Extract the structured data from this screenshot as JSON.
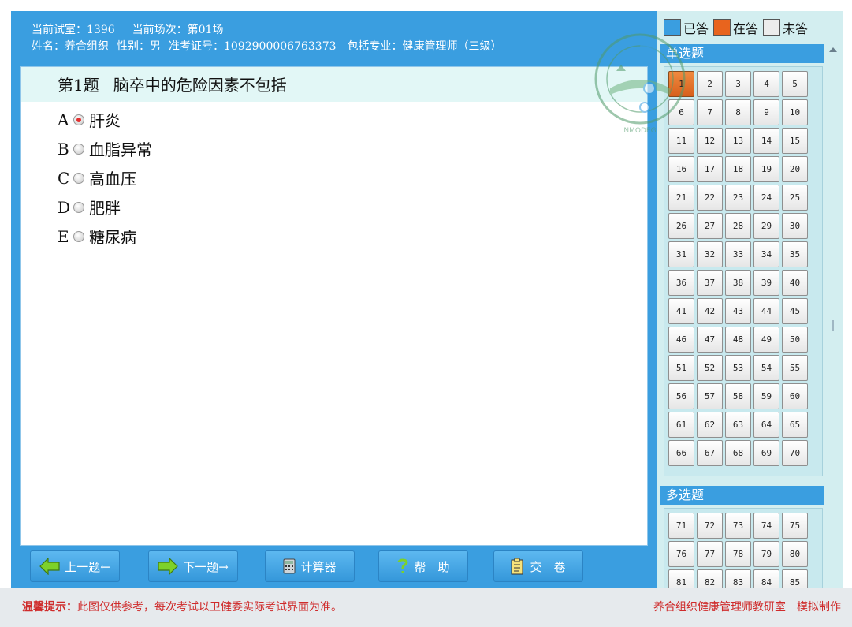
{
  "header": {
    "room_label": "当前试室：",
    "room_value": "1396",
    "session_label": "当前场次：",
    "session_value": "第01场",
    "name_label": "姓名：",
    "name_value": "养合组织",
    "gender_label": "性别：",
    "gender_value": "男",
    "id_label": "准考证号：",
    "id_value": "1092900006763373",
    "major_label": "包括专业：",
    "major_value": "健康管理师（三级）"
  },
  "question": {
    "number": "第1题",
    "text": "脑卒中的危险因素不包括",
    "selected": 0,
    "options": [
      {
        "letter": "A",
        "text": "肝炎"
      },
      {
        "letter": "B",
        "text": "血脂异常"
      },
      {
        "letter": "C",
        "text": "高血压"
      },
      {
        "letter": "D",
        "text": "肥胖"
      },
      {
        "letter": "E",
        "text": "糖尿病"
      }
    ]
  },
  "buttons": {
    "prev": "上一题←",
    "next": "下一题→",
    "calculator": "计算器",
    "help": "帮　助",
    "submit": "交　卷"
  },
  "legend": {
    "answered": "已答",
    "answering": "在答",
    "unanswered": "未答",
    "answered_color": "#3a9ee0",
    "answering_color": "#e8641e",
    "unanswered_color": "#ececec"
  },
  "single_choice": {
    "title": "单选题",
    "current": 1,
    "numbers": [
      1,
      2,
      3,
      4,
      5,
      6,
      7,
      8,
      9,
      10,
      11,
      12,
      13,
      14,
      15,
      16,
      17,
      18,
      19,
      20,
      21,
      22,
      23,
      24,
      25,
      26,
      27,
      28,
      29,
      30,
      31,
      32,
      33,
      34,
      35,
      36,
      37,
      38,
      39,
      40,
      41,
      42,
      43,
      44,
      45,
      46,
      47,
      48,
      49,
      50,
      51,
      52,
      53,
      54,
      55,
      56,
      57,
      58,
      59,
      60,
      61,
      62,
      63,
      64,
      65,
      66,
      67,
      68,
      69,
      70
    ]
  },
  "multi_choice": {
    "title": "多选题",
    "numbers": [
      71,
      72,
      73,
      74,
      75,
      76,
      77,
      78,
      79,
      80,
      81,
      82,
      83,
      84,
      85
    ]
  },
  "footer": {
    "tip_label": "温馨提示：",
    "tip_text": "此图仅供参考，每次考试以卫健委实际考试界面为准。",
    "credit": "养合组织健康管理师教研室　模拟制作"
  }
}
